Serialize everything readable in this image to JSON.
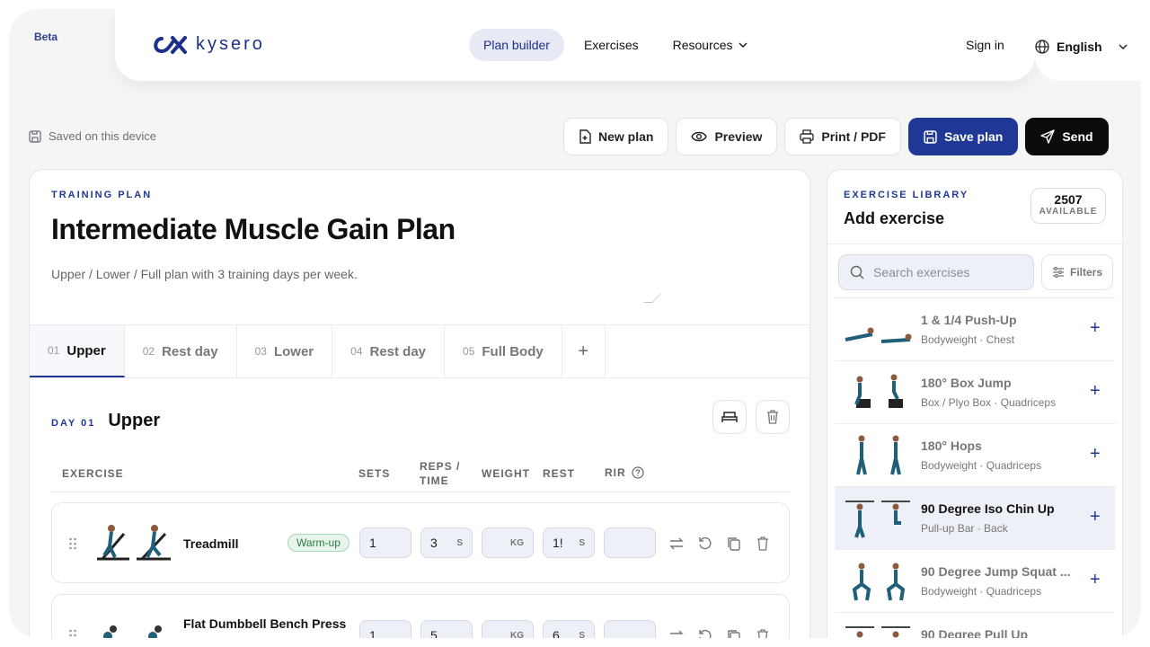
{
  "nav": {
    "beta": "Beta",
    "logo_text": "kysero",
    "links": [
      "Plan builder",
      "Exercises",
      "Resources"
    ],
    "sign_in": "Sign in",
    "language": "English"
  },
  "saved_status": "Saved on this device",
  "toolbar": {
    "new_plan": "New plan",
    "preview": "Preview",
    "print": "Print / PDF",
    "save": "Save plan",
    "send": "Send"
  },
  "plan": {
    "eyebrow": "TRAINING PLAN",
    "title": "Intermediate Muscle Gain Plan",
    "description": "Upper / Lower / Full plan with 3 training days per week.",
    "tabs": [
      {
        "num": "01",
        "label": "Upper"
      },
      {
        "num": "02",
        "label": "Rest day"
      },
      {
        "num": "03",
        "label": "Lower"
      },
      {
        "num": "04",
        "label": "Rest day"
      },
      {
        "num": "05",
        "label": "Full Body"
      }
    ],
    "add_tab": "+"
  },
  "day": {
    "eyebrow": "DAY 01",
    "title": "Upper",
    "columns": {
      "exercise": "EXERCISE",
      "sets": "SETS",
      "reps1": "REPS /",
      "reps2": "TIME",
      "weight": "WEIGHT",
      "rest": "REST",
      "rir": "RIR"
    },
    "exercises": [
      {
        "name": "Treadmill",
        "badge": "Warm-up",
        "sets": "1",
        "reps": "3",
        "reps_unit": "S",
        "weight": "",
        "weight_unit": "KG",
        "rest": "1!",
        "rest_unit": "S",
        "rir": ""
      },
      {
        "name": "Flat Dumbbell Bench Press",
        "sets": "1",
        "reps": "5",
        "weight": "",
        "weight_unit": "KG",
        "rest": "6",
        "rest_unit": "S",
        "rir": ""
      }
    ]
  },
  "library": {
    "eyebrow": "EXERCISE LIBRARY",
    "title": "Add exercise",
    "available_count": "2507",
    "available_label": "AVAILABLE",
    "search_placeholder": "Search exercises",
    "filters": "Filters",
    "items": [
      {
        "name": "1 & 1/4 Push-Up",
        "meta": "Bodyweight · Chest"
      },
      {
        "name": "180° Box Jump",
        "meta": "Box / Plyo Box · Quadriceps"
      },
      {
        "name": "180° Hops",
        "meta": "Bodyweight · Quadriceps"
      },
      {
        "name": "90 Degree Iso Chin Up",
        "meta": "Pull-up Bar · Back"
      },
      {
        "name": "90 Degree Jump Squat ...",
        "meta": "Bodyweight · Quadriceps"
      },
      {
        "name": "90 Degree Pull Up",
        "meta": ""
      }
    ]
  }
}
